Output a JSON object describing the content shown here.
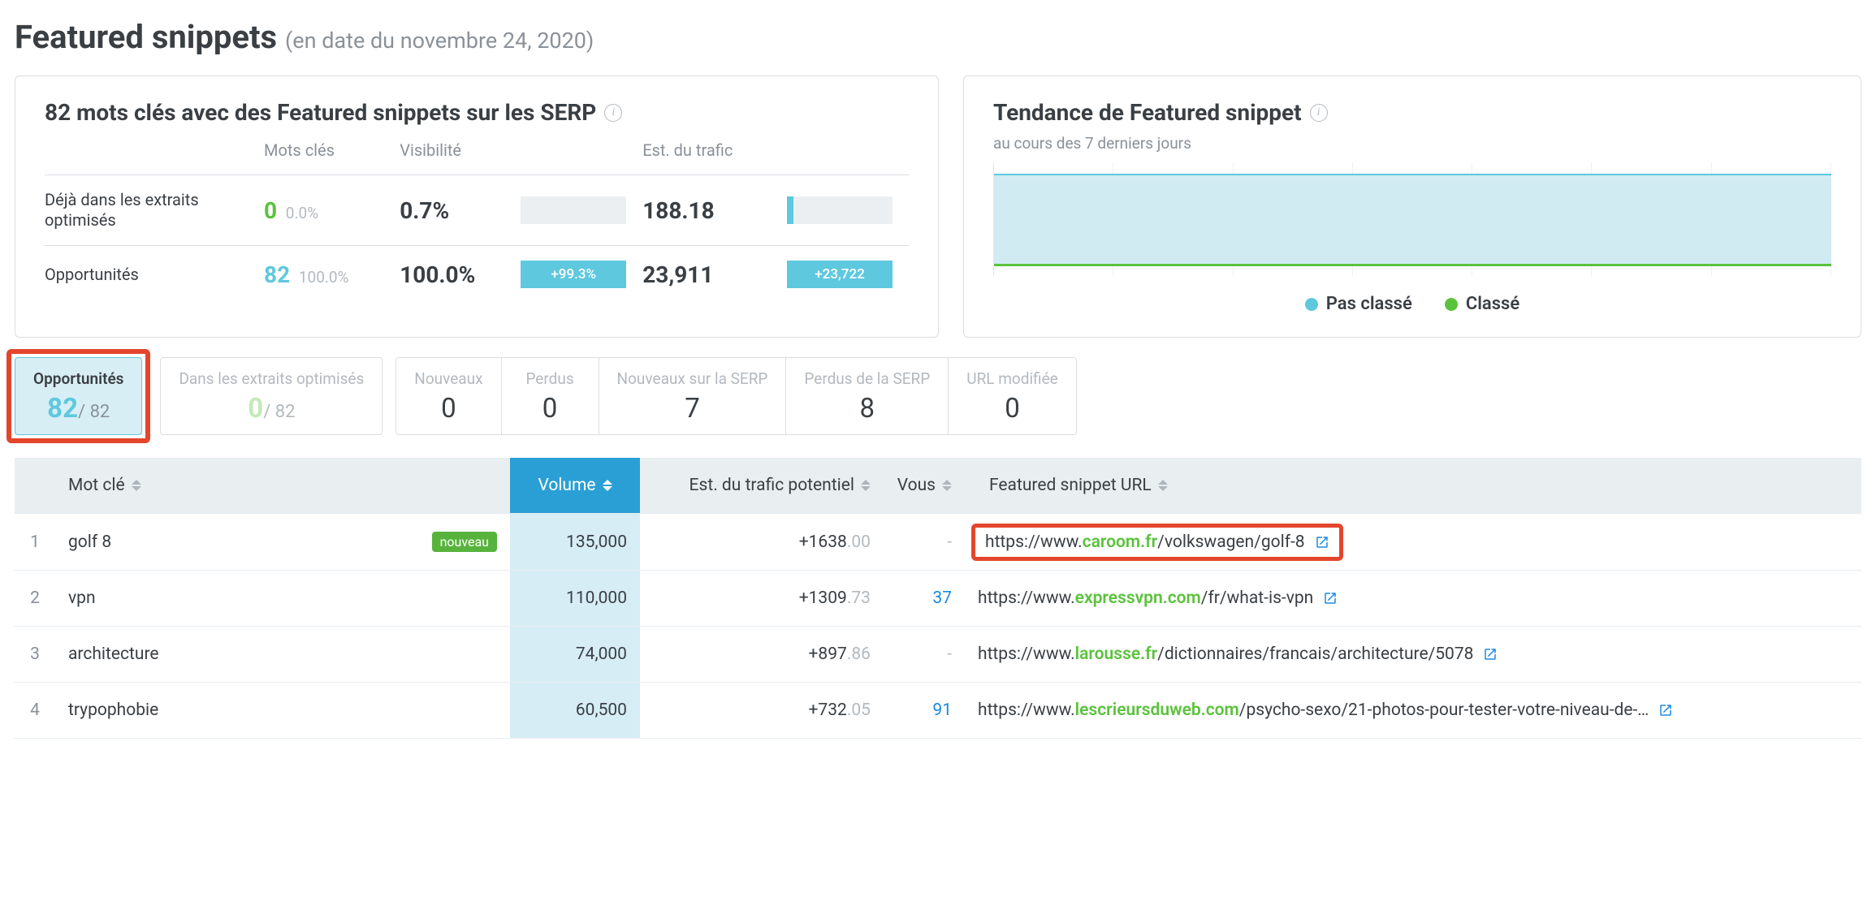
{
  "header": {
    "title": "Featured snippets",
    "subtitle": "(en date du novembre 24, 2020)"
  },
  "summary_card": {
    "title": "82 mots clés avec des Featured snippets sur les SERP",
    "columns": {
      "keywords": "Mots clés",
      "visibility": "Visibilité",
      "traffic": "Est. du trafic"
    },
    "rows": [
      {
        "label": "Déjà dans les extraits optimisés",
        "kw": "0",
        "kw_pct": "0.0%",
        "vis": "0.7%",
        "vis_delta": "",
        "traf": "188.18",
        "traf_delta": ""
      },
      {
        "label": "Opportunités",
        "kw": "82",
        "kw_pct": "100.0%",
        "vis": "100.0%",
        "vis_delta": "+99.3%",
        "traf": "23,911",
        "traf_delta": "+23,722"
      }
    ]
  },
  "trend_card": {
    "title": "Tendance de Featured snippet",
    "subtitle": "au cours des 7 derniers jours",
    "legend": {
      "unranked": "Pas classé",
      "ranked": "Classé"
    }
  },
  "chart_data": {
    "type": "area",
    "title": "Tendance de Featured snippet",
    "xlabel": "",
    "ylabel": "",
    "x": [
      1,
      2,
      3,
      4,
      5,
      6,
      7
    ],
    "series": [
      {
        "name": "Pas classé",
        "values": [
          82,
          81,
          82,
          82,
          82,
          82,
          82
        ],
        "color": "#5ec8de"
      },
      {
        "name": "Classé",
        "values": [
          0,
          0,
          0,
          0,
          0,
          0,
          0
        ],
        "color": "#6abf40"
      }
    ],
    "ylim": [
      0,
      90
    ]
  },
  "tabs": {
    "opportunites": {
      "label": "Opportunités",
      "num": "82",
      "suffix": "/ 82"
    },
    "in_snippets": {
      "label": "Dans les extraits optimisés",
      "num": "0",
      "suffix": "/ 82"
    },
    "group": [
      {
        "label": "Nouveaux",
        "num": "0"
      },
      {
        "label": "Perdus",
        "num": "0"
      },
      {
        "label": "Nouveaux sur la SERP",
        "num": "7"
      },
      {
        "label": "Perdus de la SERP",
        "num": "8"
      },
      {
        "label": "URL modifiée",
        "num": "0"
      }
    ]
  },
  "table": {
    "headers": {
      "keyword": "Mot clé",
      "volume": "Volume",
      "traffic": "Est. du trafic potentiel",
      "you": "Vous",
      "url": "Featured snippet URL"
    },
    "rows": [
      {
        "idx": "1",
        "keyword": "golf 8",
        "badge": "nouveau",
        "volume": "135,000",
        "traffic_int": "+1638",
        "traffic_frac": ".00",
        "you": "-",
        "url_pre": "https://www.",
        "url_domain": "caroom.fr",
        "url_post": "/volkswagen/golf-8",
        "highlight": true
      },
      {
        "idx": "2",
        "keyword": "vpn",
        "badge": "",
        "volume": "110,000",
        "traffic_int": "+1309",
        "traffic_frac": ".73",
        "you": "37",
        "url_pre": "https://www.",
        "url_domain": "expressvpn.com",
        "url_post": "/fr/what-is-vpn",
        "highlight": false
      },
      {
        "idx": "3",
        "keyword": "architecture",
        "badge": "",
        "volume": "74,000",
        "traffic_int": "+897",
        "traffic_frac": ".86",
        "you": "-",
        "url_pre": "https://www.",
        "url_domain": "larousse.fr",
        "url_post": "/dictionnaires/francais/architecture/5078",
        "highlight": false
      },
      {
        "idx": "4",
        "keyword": "trypophobie",
        "badge": "",
        "volume": "60,500",
        "traffic_int": "+732",
        "traffic_frac": ".05",
        "you": "91",
        "url_pre": "https://www.",
        "url_domain": "lescrieursduweb.com",
        "url_post": "/psycho-sexo/21-photos-pour-tester-votre-niveau-de-…",
        "highlight": false
      }
    ]
  }
}
